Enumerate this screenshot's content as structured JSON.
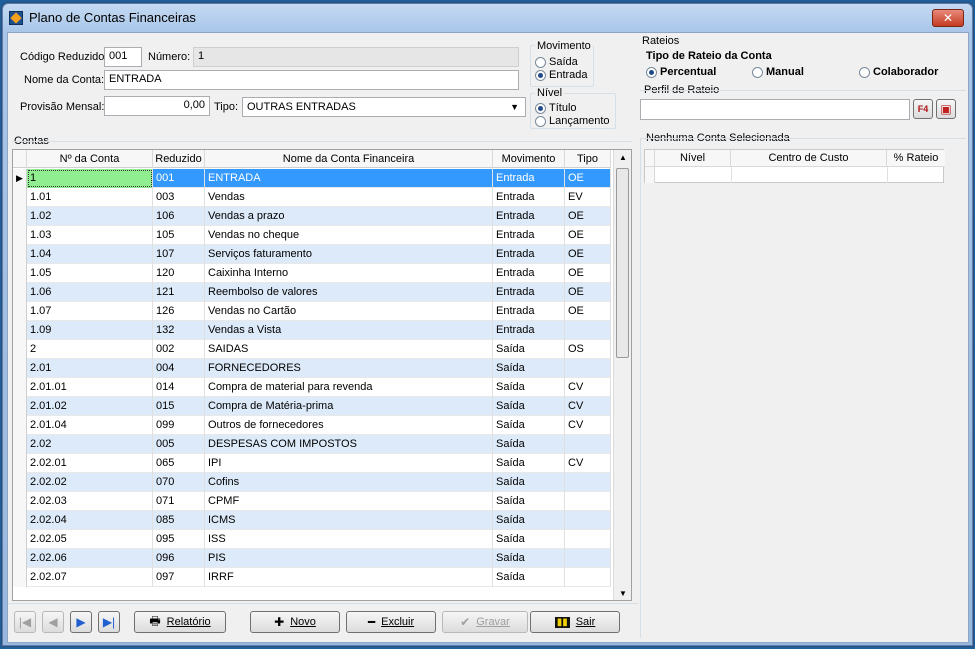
{
  "window": {
    "title": "Plano de Contas Financeiras",
    "close_label": "✕"
  },
  "form": {
    "codigo_label": "Código Reduzido",
    "codigo_value": "001",
    "numero_label": "Número:",
    "numero_value": "1",
    "nome_label": "Nome da Conta:",
    "nome_value": "ENTRADA",
    "provisao_label": "Provisão Mensal:",
    "provisao_value": "0,00",
    "tipo_label": "Tipo:",
    "tipo_value": "OUTRAS ENTRADAS"
  },
  "movimento": {
    "title": "Movimento",
    "options": [
      "Saída",
      "Entrada"
    ],
    "selected": "Entrada"
  },
  "nivel": {
    "title": "Nível",
    "options": [
      "Título",
      "Lançamento"
    ],
    "selected": "Título"
  },
  "contas": {
    "title": "Contas",
    "headers": [
      "Nº da Conta",
      "Reduzido",
      "Nome da Conta Financeira",
      "Movimento",
      "Tipo"
    ],
    "rows": [
      [
        "1",
        "001",
        "ENTRADA",
        "Entrada",
        "OE"
      ],
      [
        "1.01",
        "003",
        "Vendas",
        "Entrada",
        "EV"
      ],
      [
        "1.02",
        "106",
        "Vendas a prazo",
        "Entrada",
        "OE"
      ],
      [
        "1.03",
        "105",
        "Vendas no cheque",
        "Entrada",
        "OE"
      ],
      [
        "1.04",
        "107",
        "Serviços faturamento",
        "Entrada",
        "OE"
      ],
      [
        "1.05",
        "120",
        "Caixinha Interno",
        "Entrada",
        "OE"
      ],
      [
        "1.06",
        "121",
        "Reembolso de valores",
        "Entrada",
        "OE"
      ],
      [
        "1.07",
        "126",
        "Vendas no Cartão",
        "Entrada",
        "OE"
      ],
      [
        "1.09",
        "132",
        "Vendas a Vista",
        "Entrada",
        ""
      ],
      [
        "2",
        "002",
        "SAIDAS",
        "Saída",
        "OS"
      ],
      [
        "2.01",
        "004",
        "FORNECEDORES",
        "Saída",
        ""
      ],
      [
        "2.01.01",
        "014",
        "Compra de material para revenda",
        "Saída",
        "CV"
      ],
      [
        "2.01.02",
        "015",
        "Compra de Matéria-prima",
        "Saída",
        "CV"
      ],
      [
        "2.01.04",
        "099",
        "Outros de fornecedores",
        "Saída",
        "CV"
      ],
      [
        "2.02",
        "005",
        "DESPESAS COM IMPOSTOS",
        "Saída",
        ""
      ],
      [
        "2.02.01",
        "065",
        "IPI",
        "Saída",
        "CV"
      ],
      [
        "2.02.02",
        "070",
        "Cofins",
        "Saída",
        ""
      ],
      [
        "2.02.03",
        "071",
        "CPMF",
        "Saída",
        ""
      ],
      [
        "2.02.04",
        "085",
        "ICMS",
        "Saída",
        ""
      ],
      [
        "2.02.05",
        "095",
        "ISS",
        "Saída",
        ""
      ],
      [
        "2.02.06",
        "096",
        "PIS",
        "Saída",
        ""
      ],
      [
        "2.02.07",
        "097",
        "IRRF",
        "Saída",
        ""
      ]
    ],
    "selected_row": 0
  },
  "rateios": {
    "title": "Rateios",
    "tipo_title": "Tipo de Rateio da Conta",
    "tipo_options": [
      "Percentual",
      "Manual",
      "Colaborador"
    ],
    "tipo_selected": "Percentual",
    "perfil_title": "Perfil de Rateio",
    "perfil_value": "",
    "f4_label": "F4",
    "nenhuma_title": "Nenhuma Conta Selecionada",
    "headers": [
      "Nível",
      "Centro de Custo",
      "% Rateio"
    ]
  },
  "toolbar": {
    "relatorio": "Relatório",
    "novo": "Novo",
    "excluir": "Excluir",
    "gravar": "Gravar",
    "sair": "Sair"
  }
}
